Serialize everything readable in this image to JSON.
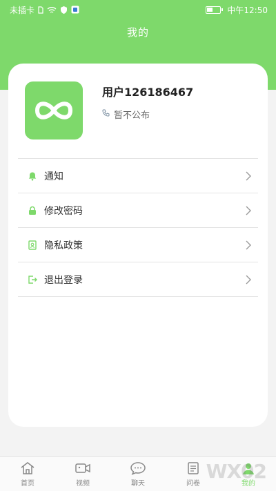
{
  "status_bar": {
    "carrier": "未插卡",
    "time": "中午12:50"
  },
  "header": {
    "title": "我的"
  },
  "profile": {
    "username": "用户126186467",
    "phone": "暂不公布"
  },
  "menu": [
    {
      "label": "通知",
      "icon": "bell-icon"
    },
    {
      "label": "修改密码",
      "icon": "lock-icon"
    },
    {
      "label": "隐私政策",
      "icon": "document-icon"
    },
    {
      "label": "退出登录",
      "icon": "logout-icon"
    }
  ],
  "tabs": [
    {
      "label": "首页",
      "icon": "home-icon"
    },
    {
      "label": "视频",
      "icon": "video-icon"
    },
    {
      "label": "聊天",
      "icon": "chat-icon"
    },
    {
      "label": "问卷",
      "icon": "survey-icon"
    },
    {
      "label": "我的",
      "icon": "profile-icon"
    }
  ],
  "watermark": "WX02",
  "colors": {
    "accent": "#7ed96b",
    "background": "#f3f3f3"
  }
}
